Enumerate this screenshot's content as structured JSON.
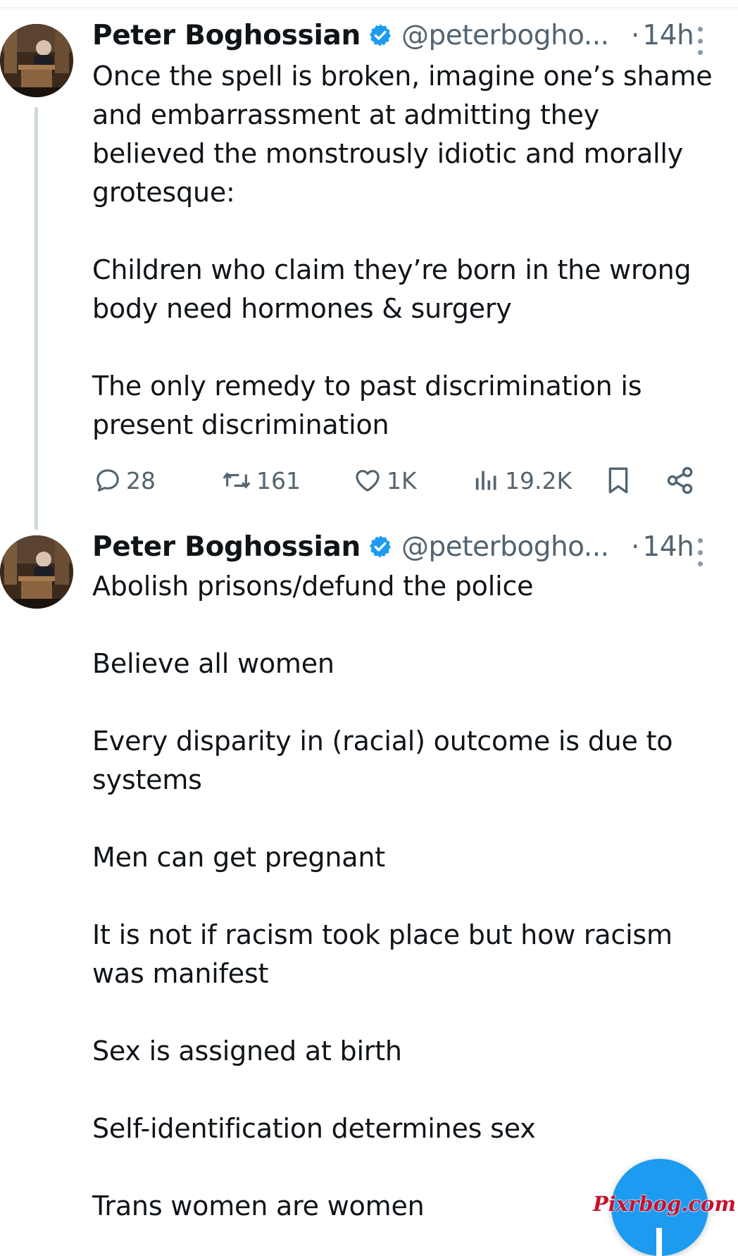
{
  "tweets": [
    {
      "author": {
        "name": "Peter Boghossian",
        "handle": "@peterbogho...",
        "avatar_icon": "avatar-photo-lectern",
        "verified_icon": "verified-badge-icon"
      },
      "separator": "·",
      "time": "14h",
      "lines": [
        "Once the spell is broken, imagine one’s shame",
        "and embarrassment at admitting they",
        "believed the monstrously idiotic and morally",
        "grotesque:",
        "Children who claim they’re born in the wrong",
        "body need hormones & surgery",
        "The only remedy to past discrimination is",
        "present discrimination"
      ],
      "actions": {
        "reply": {
          "icon": "reply-icon",
          "count": "28"
        },
        "repost": {
          "icon": "repost-icon",
          "count": "161"
        },
        "like": {
          "icon": "heart-icon",
          "count": "1K"
        },
        "views": {
          "icon": "views-chart-icon",
          "count": "19.2K"
        },
        "bookmark": {
          "icon": "bookmark-icon"
        },
        "share": {
          "icon": "share-icon"
        }
      }
    },
    {
      "author": {
        "name": "Peter Boghossian",
        "handle": "@peterbogho...",
        "avatar_icon": "avatar-photo-lectern",
        "verified_icon": "verified-badge-icon"
      },
      "separator": "·",
      "time": "14h",
      "lines": [
        "Abolish prisons/defund the police",
        "Believe all women",
        "Every disparity in (racial) outcome is due to",
        "systems",
        "Men can get pregnant",
        "It is not if racism took place but how racism",
        "was manifest",
        "Sex is assigned at birth",
        "Self-identification determines sex",
        "Trans women are women"
      ]
    }
  ],
  "compose_button": {
    "icon": "plus-icon"
  },
  "watermark": "Pixrbog.com",
  "colors": {
    "text_primary": "#0f1419",
    "text_secondary": "#536471",
    "accent_blue": "#1d9bf0",
    "thread_line": "#cfd9de",
    "watermark_red": "#c8102e"
  }
}
